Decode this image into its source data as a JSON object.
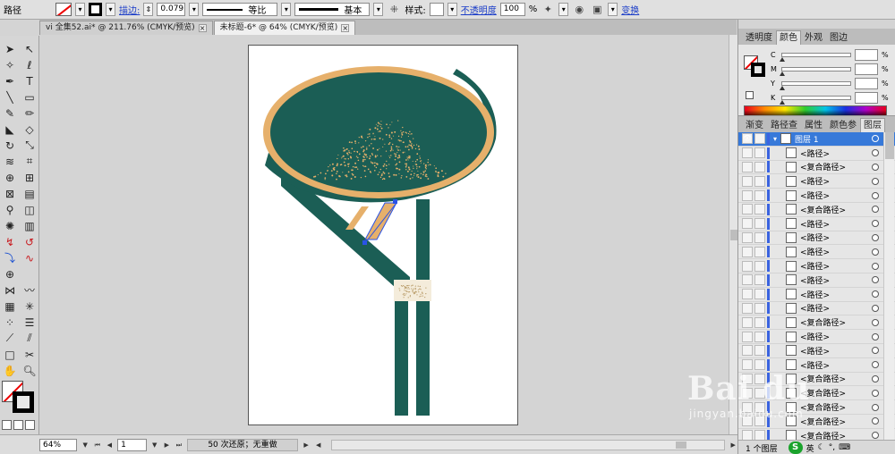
{
  "controlbar": {
    "object_label": "路径",
    "stroke_label": "描边:",
    "stroke_weight": "0.079",
    "profile_label": "等比",
    "brush_label": "基本",
    "style_label": "样式:",
    "opacity_label": "不透明度",
    "opacity_value": "100",
    "opacity_unit": "%",
    "transform_label": "变换"
  },
  "doctabs": [
    {
      "label": "vi 全集52.ai* @ 211.76% (CMYK/预览)",
      "active": false
    },
    {
      "label": "未标题-6* @ 64% (CMYK/预览)",
      "active": true
    }
  ],
  "tab_close_glyph": "×",
  "statusbar": {
    "zoom": "64%",
    "artboard_number": "1",
    "undo_text": "50 次还原；无重做"
  },
  "color_panel": {
    "tabs": [
      "透明度",
      "颜色",
      "外观",
      "图边"
    ],
    "active_tab": 1,
    "channels": [
      {
        "label": "C",
        "unit": "%"
      },
      {
        "label": "M",
        "unit": "%"
      },
      {
        "label": "Y",
        "unit": "%"
      },
      {
        "label": "K",
        "unit": "%"
      }
    ]
  },
  "layers_panel": {
    "tabs": [
      "渐变",
      "路径查",
      "属性",
      "颜色参",
      "图层"
    ],
    "active_tab": 4,
    "layer_name": "图层 1",
    "items": [
      "<路径>",
      "<复合路径>",
      "<路径>",
      "<路径>",
      "<复合路径>",
      "<路径>",
      "<路径>",
      "<路径>",
      "<路径>",
      "<路径>",
      "<路径>",
      "<路径>",
      "<复合路径>",
      "<路径>",
      "<路径>",
      "<路径>",
      "<复合路径>",
      "<复合路径>",
      "<复合路径>",
      "<复合路径>",
      "<复合路径>"
    ],
    "footer_text": "1 个图层",
    "ime_text": "英"
  },
  "watermark": {
    "logo": "Bai du",
    "sub": "jingyan.baidu.com"
  },
  "colors": {
    "teal": "#1b5e55",
    "tan": "#e6b06b",
    "cream": "#f4ecdb",
    "selection": "#2a53e6",
    "layer_highlight": "#3779d9"
  },
  "icons": {
    "selection": "selection-tool-icon",
    "direct_selection": "direct-selection-tool-icon",
    "pen": "pen-tool-icon",
    "type": "type-tool-icon",
    "hand": "hand-tool-icon",
    "zoom": "zoom-tool-icon"
  }
}
